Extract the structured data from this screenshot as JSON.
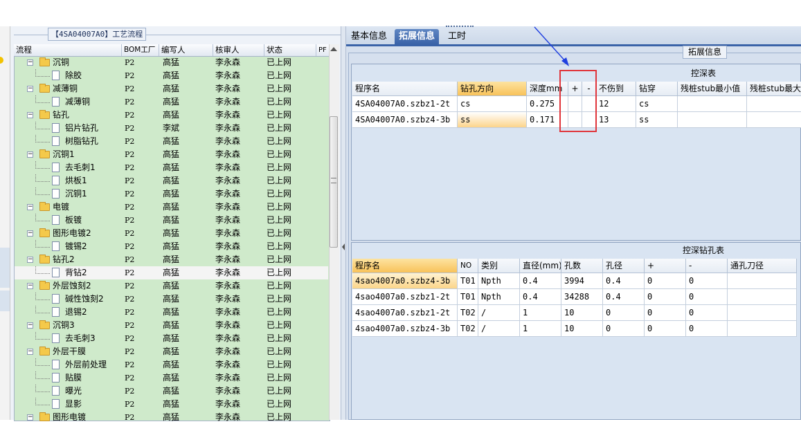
{
  "tree": {
    "title": "【4SA04007A0】工艺流程",
    "columns": [
      "流程",
      "BOM工厂",
      "编写人",
      "核审人",
      "状态",
      "PF"
    ],
    "rows": [
      {
        "level": 1,
        "type": "folder",
        "name": "沉铜",
        "bom": "P2",
        "writer": "高猛",
        "reviewer": "李永森",
        "status": "已上网"
      },
      {
        "level": 2,
        "type": "doc",
        "name": "除胶",
        "bom": "P2",
        "writer": "高猛",
        "reviewer": "李永森",
        "status": "已上网"
      },
      {
        "level": 1,
        "type": "folder",
        "name": "减薄铜",
        "bom": "P2",
        "writer": "高猛",
        "reviewer": "李永森",
        "status": "已上网"
      },
      {
        "level": 2,
        "type": "doc",
        "name": "减薄铜",
        "bom": "P2",
        "writer": "高猛",
        "reviewer": "李永森",
        "status": "已上网"
      },
      {
        "level": 1,
        "type": "folder",
        "name": "钻孔",
        "bom": "P2",
        "writer": "高猛",
        "reviewer": "李永森",
        "status": "已上网"
      },
      {
        "level": 2,
        "type": "doc",
        "name": "铝片钻孔",
        "bom": "P2",
        "writer": "李斌",
        "reviewer": "李永森",
        "status": "已上网"
      },
      {
        "level": 2,
        "type": "doc",
        "name": "树脂钻孔",
        "bom": "P2",
        "writer": "高猛",
        "reviewer": "李永森",
        "status": "已上网"
      },
      {
        "level": 1,
        "type": "folder",
        "name": "沉铜1",
        "bom": "P2",
        "writer": "高猛",
        "reviewer": "李永森",
        "status": "已上网"
      },
      {
        "level": 2,
        "type": "doc",
        "name": "去毛刺1",
        "bom": "P2",
        "writer": "高猛",
        "reviewer": "李永森",
        "status": "已上网"
      },
      {
        "level": 2,
        "type": "doc",
        "name": "烘板1",
        "bom": "P2",
        "writer": "高猛",
        "reviewer": "李永森",
        "status": "已上网"
      },
      {
        "level": 2,
        "type": "doc",
        "name": "沉铜1",
        "bom": "P2",
        "writer": "高猛",
        "reviewer": "李永森",
        "status": "已上网"
      },
      {
        "level": 1,
        "type": "folder",
        "name": "电镀",
        "bom": "P2",
        "writer": "高猛",
        "reviewer": "李永森",
        "status": "已上网"
      },
      {
        "level": 2,
        "type": "doc",
        "name": "板镀",
        "bom": "P2",
        "writer": "高猛",
        "reviewer": "李永森",
        "status": "已上网"
      },
      {
        "level": 1,
        "type": "folder",
        "name": "图形电镀2",
        "bom": "P2",
        "writer": "高猛",
        "reviewer": "李永森",
        "status": "已上网"
      },
      {
        "level": 2,
        "type": "doc",
        "name": "镀锡2",
        "bom": "P2",
        "writer": "高猛",
        "reviewer": "李永森",
        "status": "已上网"
      },
      {
        "level": 1,
        "type": "folder",
        "name": "钻孔2",
        "bom": "P2",
        "writer": "高猛",
        "reviewer": "李永森",
        "status": "已上网"
      },
      {
        "level": 2,
        "type": "doc",
        "name": "背钻2",
        "bom": "P2",
        "writer": "高猛",
        "reviewer": "李永森",
        "status": "已上网",
        "selected": true
      },
      {
        "level": 1,
        "type": "folder",
        "name": "外层蚀刻2",
        "bom": "P2",
        "writer": "高猛",
        "reviewer": "李永森",
        "status": "已上网"
      },
      {
        "level": 2,
        "type": "doc",
        "name": "碱性蚀刻2",
        "bom": "P2",
        "writer": "高猛",
        "reviewer": "李永森",
        "status": "已上网"
      },
      {
        "level": 2,
        "type": "doc",
        "name": "退锡2",
        "bom": "P2",
        "writer": "高猛",
        "reviewer": "李永森",
        "status": "已上网"
      },
      {
        "level": 1,
        "type": "folder",
        "name": "沉铜3",
        "bom": "P2",
        "writer": "高猛",
        "reviewer": "李永森",
        "status": "已上网"
      },
      {
        "level": 2,
        "type": "doc",
        "name": "去毛刺3",
        "bom": "P2",
        "writer": "高猛",
        "reviewer": "李永森",
        "status": "已上网"
      },
      {
        "level": 1,
        "type": "folder",
        "name": "外层干膜",
        "bom": "P2",
        "writer": "高猛",
        "reviewer": "李永森",
        "status": "已上网"
      },
      {
        "level": 2,
        "type": "doc",
        "name": "外层前处理",
        "bom": "P2",
        "writer": "高猛",
        "reviewer": "李永森",
        "status": "已上网"
      },
      {
        "level": 2,
        "type": "doc",
        "name": "贴膜",
        "bom": "P2",
        "writer": "高猛",
        "reviewer": "李永森",
        "status": "已上网"
      },
      {
        "level": 2,
        "type": "doc",
        "name": "曝光",
        "bom": "P2",
        "writer": "高猛",
        "reviewer": "李永森",
        "status": "已上网"
      },
      {
        "level": 2,
        "type": "doc",
        "name": "显影",
        "bom": "P2",
        "writer": "高猛",
        "reviewer": "李永森",
        "status": "已上网"
      },
      {
        "level": 1,
        "type": "folder",
        "name": "图形电镀",
        "bom": "P2",
        "writer": "高猛",
        "reviewer": "李永森",
        "status": "已上网"
      }
    ]
  },
  "tabs": [
    "基本信息",
    "拓展信息",
    "工时"
  ],
  "active_tab": "拓展信息",
  "group_title": "拓展信息",
  "deep_table": {
    "caption": "控深表",
    "columns": [
      "程序名",
      "钻孔方向",
      "深度mm",
      "+",
      "-",
      "不伤到",
      "钻穿",
      "残桩stub最小值",
      "残桩stub最大"
    ],
    "rows": [
      [
        "4SA04007A0.szbz1-2t",
        "cs",
        "0.275",
        "",
        "",
        "12",
        "cs",
        "",
        ""
      ],
      [
        "4SA04007A0.szbz4-3b",
        "ss",
        "0.171",
        "",
        "",
        "13",
        "ss",
        "",
        ""
      ]
    ]
  },
  "drill_table": {
    "caption": "控深钻孔表",
    "columns": [
      "程序名",
      "NO",
      "类别",
      "直径(mm)",
      "孔数",
      "孔径",
      "+",
      "-",
      "通孔刀径"
    ],
    "rows": [
      [
        "4sao4007a0.szbz4-3b",
        "T01",
        "Npth",
        "0.4",
        "3994",
        "0.4",
        "0",
        "0",
        ""
      ],
      [
        "4sao4007a0.szbz1-2t",
        "T01",
        "Npth",
        "0.4",
        "34288",
        "0.4",
        "0",
        "0",
        ""
      ],
      [
        "4sao4007a0.szbz1-2t",
        "T02",
        "/",
        "1",
        "10",
        "0",
        "0",
        "0",
        ""
      ],
      [
        "4sao4007a0.szbz4-3b",
        "T02",
        "/",
        "1",
        "10",
        "0",
        "0",
        "0",
        ""
      ]
    ]
  },
  "colors": {
    "annotation_box": "#e0343a",
    "annotation_arrow": "#1f3fe0",
    "tree_bg": "#cfeacb",
    "active_tab": "#3a63a8"
  }
}
